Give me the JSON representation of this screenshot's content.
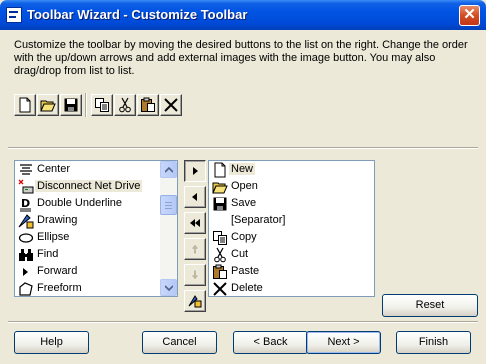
{
  "window": {
    "title": "Toolbar Wizard - Customize Toolbar",
    "close_glyph": "✕",
    "colors": {
      "title_bar": "#0054e3",
      "dialog_bg": "#ece9d8",
      "close_button": "#d24d23"
    }
  },
  "description": "Customize the toolbar by moving the desired buttons to the list on the right. Change the order\nwith the up/down arrows and add external images with the image button. You may also\ndrag/drop from list to list.",
  "top_toolbar": {
    "buttons": [
      {
        "icon": "new-file-icon"
      },
      {
        "icon": "open-folder-icon"
      },
      {
        "icon": "save-disk-icon"
      },
      {
        "icon": "copy-icon"
      },
      {
        "icon": "cut-scissors-icon"
      },
      {
        "icon": "paste-icon"
      },
      {
        "icon": "delete-x-icon"
      }
    ]
  },
  "available_list": {
    "items": [
      {
        "label": "Center",
        "icon": "center-align-icon"
      },
      {
        "label": "Disconnect Net Drive",
        "icon": "disconnect-drive-icon",
        "selected": true
      },
      {
        "label": "Double Underline",
        "icon": "double-underline-icon"
      },
      {
        "label": "Drawing",
        "icon": "drawing-icon"
      },
      {
        "label": "Ellipse",
        "icon": "ellipse-icon"
      },
      {
        "label": "Find",
        "icon": "binoculars-icon"
      },
      {
        "label": "Forward",
        "icon": "forward-arrow-icon"
      },
      {
        "label": "Freeform",
        "icon": "freeform-icon"
      }
    ]
  },
  "middle_buttons": [
    {
      "icon": "move-right-icon"
    },
    {
      "icon": "move-left-icon"
    },
    {
      "icon": "remove-all-icon"
    },
    {
      "icon": "move-up-icon"
    },
    {
      "icon": "move-down-icon"
    },
    {
      "icon": "add-image-icon"
    }
  ],
  "toolbar_list": {
    "items": [
      {
        "label": "New",
        "icon": "new-file-icon",
        "selected": true
      },
      {
        "label": "Open",
        "icon": "open-folder-icon"
      },
      {
        "label": "Save",
        "icon": "save-disk-icon"
      },
      {
        "label": "[Separator]",
        "icon": ""
      },
      {
        "label": "Copy",
        "icon": "copy-icon"
      },
      {
        "label": "Cut",
        "icon": "cut-scissors-icon"
      },
      {
        "label": "Paste",
        "icon": "paste-icon"
      },
      {
        "label": "Delete",
        "icon": "delete-x-icon"
      }
    ]
  },
  "reset_button": {
    "label": "Reset"
  },
  "footer": {
    "help": "Help",
    "cancel": "Cancel",
    "back": "< Back",
    "next": "Next >",
    "finish": "Finish"
  }
}
